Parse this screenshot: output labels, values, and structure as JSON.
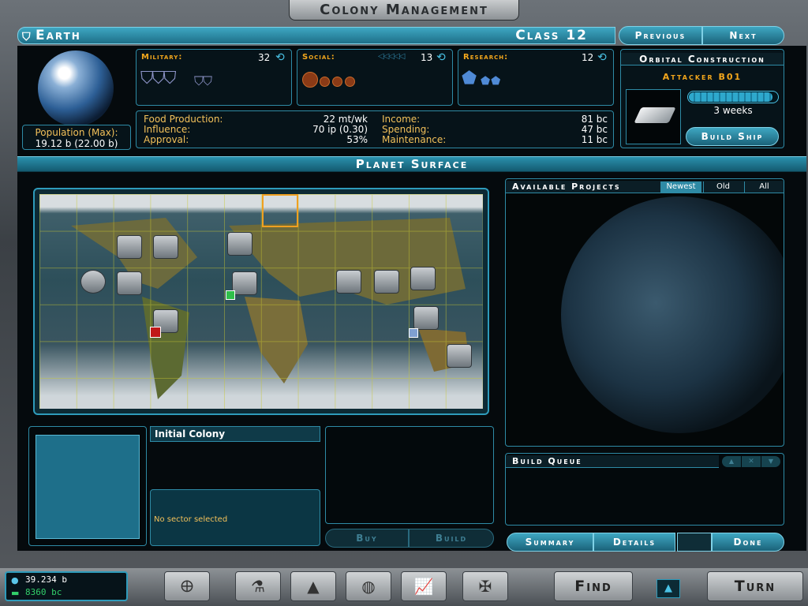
{
  "window": {
    "title": "Colony Management"
  },
  "planet": {
    "name": "Earth",
    "class": "Class 12"
  },
  "nav": {
    "previous": "Previous",
    "next": "Next"
  },
  "population": {
    "label": "Population (Max):",
    "value": "19.12 b (22.00 b)"
  },
  "military": {
    "label": "Military:",
    "value": "32"
  },
  "social": {
    "label": "Social:",
    "arrows": "◁◁◁◁◁",
    "value": "13"
  },
  "research": {
    "label": "Research:",
    "value": "12"
  },
  "stats": {
    "food_label": "Food Production:",
    "food_value": "22 mt/wk",
    "influence_label": "Influence:",
    "influence_value": "70 ip (0.30)",
    "approval_label": "Approval:",
    "approval_value": "53%",
    "income_label": "Income:",
    "income_value": "81 bc",
    "spending_label": "Spending:",
    "spending_value": "47 bc",
    "maintenance_label": "Maintenance:",
    "maintenance_value": "11 bc"
  },
  "orbital": {
    "title": "Orbital Construction",
    "ship": "Attacker B01",
    "time": "3 weeks",
    "progress": 0.95,
    "build_ship": "Build Ship"
  },
  "surface": {
    "title": "Planet Surface"
  },
  "projects": {
    "title": "Available Projects",
    "tabs": [
      "Newest",
      "Old",
      "All"
    ]
  },
  "sector": {
    "name": "Initial Colony",
    "status": "No sector selected"
  },
  "actions": {
    "buy": "Buy",
    "build": "Build"
  },
  "queue": {
    "title": "Build Queue"
  },
  "bottom": {
    "summary": "Summary",
    "details": "Details",
    "done": "Done"
  },
  "footer": {
    "population": "39.234 b",
    "credits": "8360 bc",
    "find": "Find",
    "turn": "Turn"
  },
  "colors": {
    "accent": "#2e9bbb",
    "label": "#f3a71c",
    "green": "#32d06a"
  }
}
